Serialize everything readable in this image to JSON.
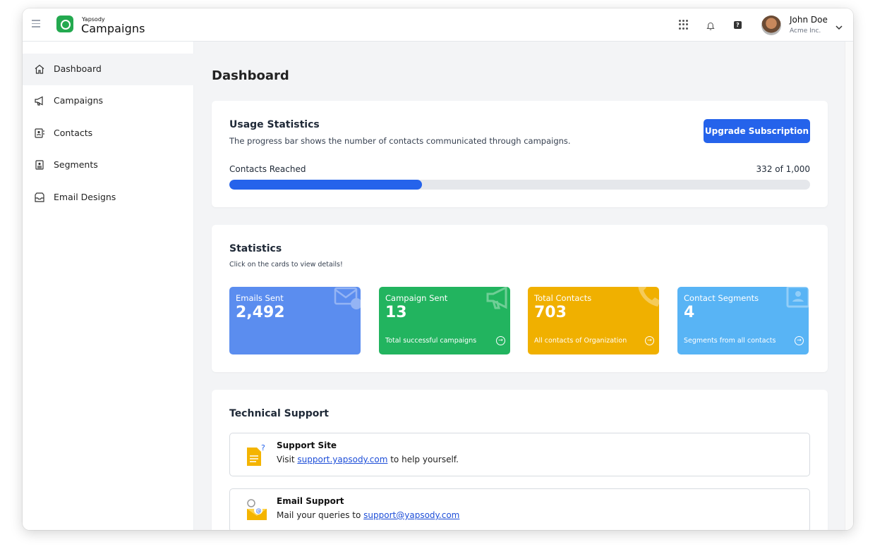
{
  "header": {
    "brand_small": "Yapsody",
    "brand_big": "Campaigns",
    "help_glyph": "?",
    "user_name": "John Doe",
    "user_org": "Acme Inc."
  },
  "sidebar": {
    "items": [
      {
        "label": "Dashboard",
        "icon": "home-icon",
        "active": true
      },
      {
        "label": "Campaigns",
        "icon": "megaphone-icon",
        "active": false
      },
      {
        "label": "Contacts",
        "icon": "contact-card-icon",
        "active": false
      },
      {
        "label": "Segments",
        "icon": "segment-card-icon",
        "active": false
      },
      {
        "label": "Email Designs",
        "icon": "inbox-icon",
        "active": false
      }
    ]
  },
  "main": {
    "page_title": "Dashboard",
    "usage": {
      "title": "Usage Statistics",
      "description": "The progress bar shows the number of contacts communicated through campaigns.",
      "upgrade_label": "Upgrade Subscription",
      "progress_label": "Contacts Reached",
      "progress_count_text": "332 of 1,000",
      "progress_value": 332,
      "progress_max": 1000
    },
    "statistics": {
      "title": "Statistics",
      "subtitle": "Click on the cards to view details!",
      "cards": [
        {
          "label": "Emails Sent",
          "value": "2,492",
          "footer": "",
          "color": "#5b8def",
          "icon": "email-check-icon"
        },
        {
          "label": "Campaign Sent",
          "value": "13",
          "footer": "Total successful campaigns",
          "color": "#22b45f",
          "icon": "megaphone-icon"
        },
        {
          "label": "Total Contacts",
          "value": "703",
          "footer": "All contacts of Organization",
          "color": "#f0b000",
          "icon": "phone-icon"
        },
        {
          "label": "Contact Segments",
          "value": "4",
          "footer": "Segments from all contacts",
          "color": "#58b4f5",
          "icon": "contact-card-icon"
        }
      ]
    },
    "support": {
      "title": "Technical Support",
      "rows": [
        {
          "title": "Support Site",
          "prefix": "Visit ",
          "link": "support.yapsody.com",
          "suffix": " to help yourself.",
          "icon": "document-question-icon"
        },
        {
          "title": "Email Support",
          "prefix": "Mail your queries to ",
          "link": "support@yapsody.com",
          "suffix": "",
          "icon": "email-gear-icon"
        }
      ]
    }
  }
}
